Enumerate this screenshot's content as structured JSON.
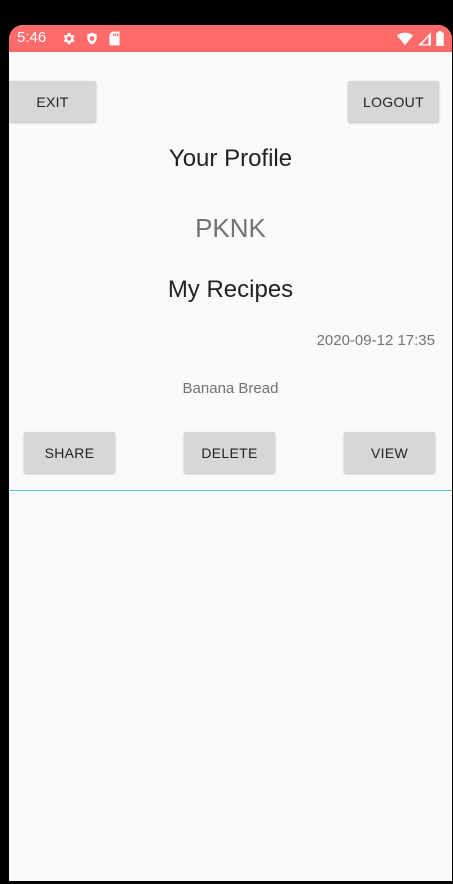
{
  "status_bar": {
    "time": "5:46",
    "color": "#ff6b6b",
    "left_icons": [
      "settings-gear-icon",
      "shield-icon",
      "sd-card-icon"
    ],
    "right_icons": [
      "wifi-icon",
      "cell-signal-icon",
      "battery-icon"
    ]
  },
  "toolbar": {
    "exit_label": "EXIT",
    "logout_label": "LOGOUT"
  },
  "profile": {
    "title": "Your Profile",
    "username": "PKNK",
    "recipes_title": "My Recipes"
  },
  "recipes": [
    {
      "date": "2020-09-12 17:35",
      "name": "Banana Bread",
      "share_label": "SHARE",
      "delete_label": "DELETE",
      "view_label": "VIEW"
    }
  ],
  "colors": {
    "accent": "#5cc8c8",
    "button_bg": "#d6d7d7",
    "background": "#fafafa"
  }
}
